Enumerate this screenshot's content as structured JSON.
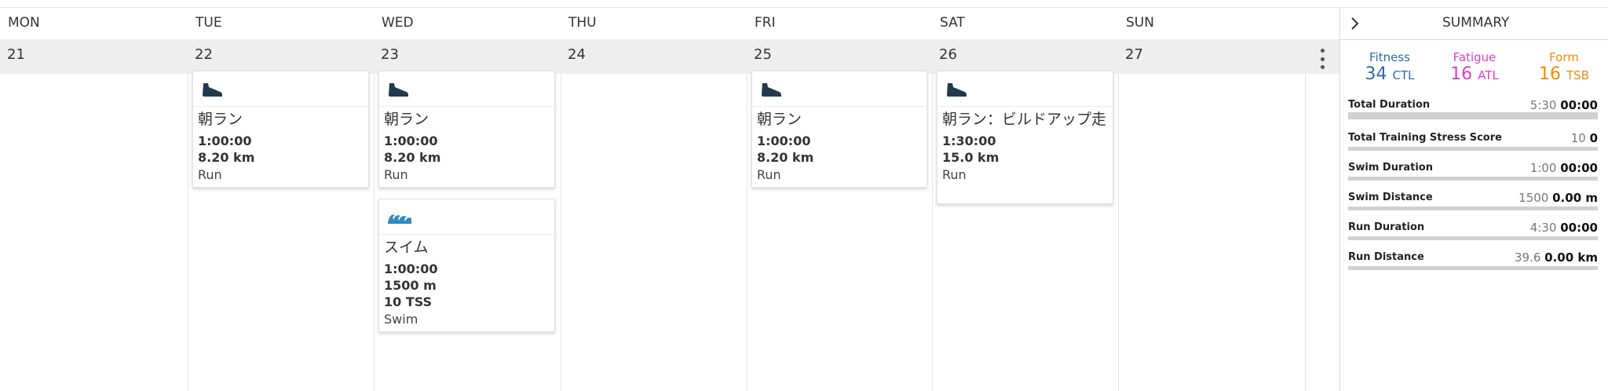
{
  "calendar": {
    "days": [
      {
        "name": "MON",
        "date": "21"
      },
      {
        "name": "TUE",
        "date": "22"
      },
      {
        "name": "WED",
        "date": "23"
      },
      {
        "name": "THU",
        "date": "24"
      },
      {
        "name": "FRI",
        "date": "25"
      },
      {
        "name": "SAT",
        "date": "26"
      },
      {
        "name": "SUN",
        "date": "27"
      }
    ],
    "workouts": {
      "tue_run": {
        "icon": "running-shoe-icon",
        "title": "朝ラン",
        "duration": "1:00:00",
        "distance": "8.20 km",
        "sport": "Run"
      },
      "wed_run": {
        "icon": "running-shoe-icon",
        "title": "朝ラン",
        "duration": "1:00:00",
        "distance": "8.20 km",
        "sport": "Run"
      },
      "wed_swim": {
        "icon": "swim-wave-icon",
        "title": "スイム",
        "duration": "1:00:00",
        "distance": "1500 m",
        "tss": "10 TSS",
        "sport": "Swim"
      },
      "fri_run": {
        "icon": "running-shoe-icon",
        "title": "朝ラン",
        "duration": "1:00:00",
        "distance": "8.20 km",
        "sport": "Run"
      },
      "sat_run": {
        "icon": "running-shoe-icon",
        "title": "朝ラン：ビルドアップ走",
        "duration": "1:30:00",
        "distance": "15.0 km",
        "sport": "Run"
      }
    },
    "colors": {
      "run_icon": "#1f3a4d",
      "swim_icon": "#2e8bc0",
      "date_row_bg": "#eeeeee"
    }
  },
  "summary": {
    "title": "SUMMARY",
    "expand_icon": "chevron-right-icon",
    "fitness": {
      "label": "Fitness",
      "value": "34",
      "unit": "CTL",
      "color": "#2f6aa8"
    },
    "fatigue": {
      "label": "Fatigue",
      "value": "16",
      "unit": "ATL",
      "color": "#e03bd0"
    },
    "form": {
      "label": "Form",
      "value": "16",
      "unit": "TSB",
      "color": "#f08c00"
    },
    "rows": [
      {
        "label": "Total Duration",
        "planned": "5:30",
        "completed": "00:00"
      },
      {
        "label": "Total Training Stress Score",
        "planned": "10",
        "completed": "0"
      },
      {
        "label": "Swim Duration",
        "planned": "1:00",
        "completed": "00:00"
      },
      {
        "label": "Swim Distance",
        "planned": "1500",
        "completed": "0.00 m"
      },
      {
        "label": "Run Duration",
        "planned": "4:30",
        "completed": "00:00"
      },
      {
        "label": "Run Distance",
        "planned": "39.6",
        "completed": "0.00 km"
      }
    ]
  }
}
